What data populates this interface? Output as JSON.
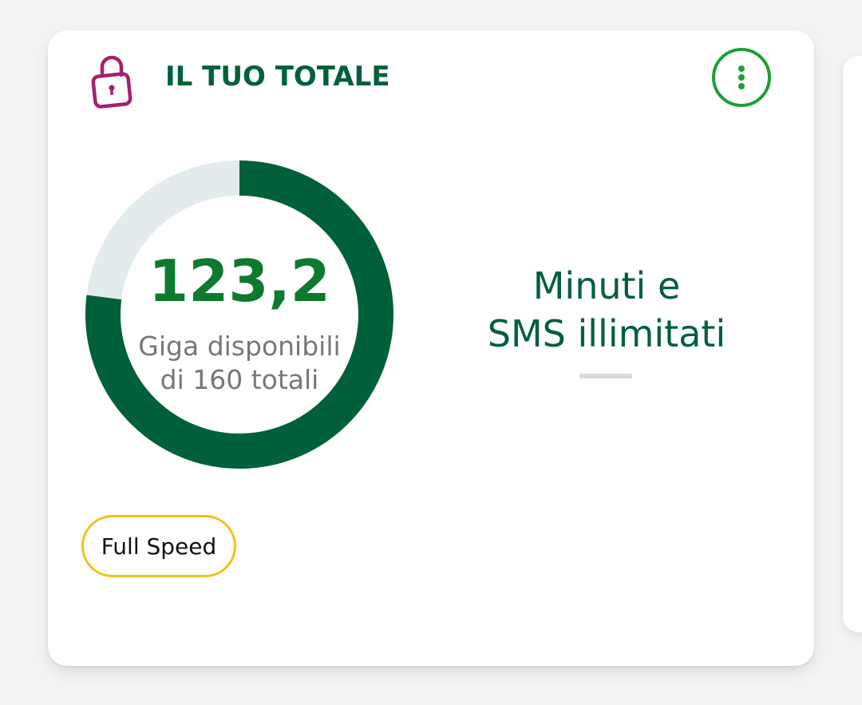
{
  "card": {
    "title": "IL TUO TOTALE",
    "icon": "lock-icon",
    "menu_icon": "more-vertical-icon"
  },
  "data_usage": {
    "available": 123.2,
    "available_label": "123,2",
    "total": 160,
    "caption_line1": "Giga disponibili",
    "caption_line2": "di 160 totali",
    "fill_fraction": 0.77
  },
  "minutes": {
    "line1": "Minuti e",
    "line2": "SMS illimitati"
  },
  "badge": {
    "label": "Full Speed"
  },
  "colors": {
    "brand_green": "#006039",
    "accent_green": "#1e9e3a",
    "value_green": "#0d7a2e",
    "donut_track": "#e3ebed",
    "lock_magenta": "#a2226f",
    "badge_border": "#f2c21b"
  }
}
